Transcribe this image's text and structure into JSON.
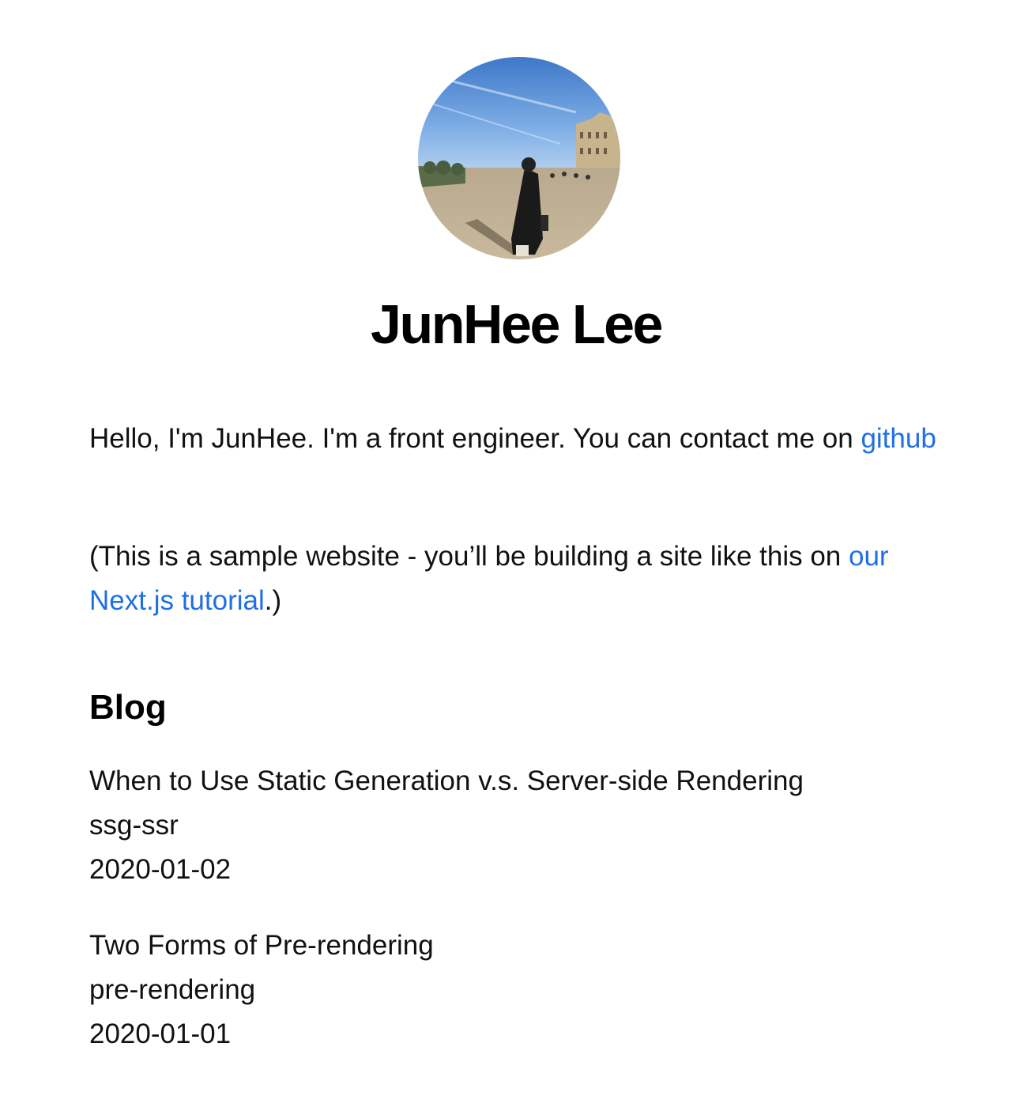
{
  "profile": {
    "avatar_alt": "avatar-photo",
    "name": "JunHee Lee"
  },
  "intro": {
    "text": "Hello, I'm JunHee. I'm a front engineer. You can contact me on ",
    "github_link": "github"
  },
  "note": {
    "prefix": "(This is a sample website - you’ll be building a site like this on ",
    "link": "our Next.js tutorial",
    "suffix": ".)"
  },
  "blog": {
    "heading": "Blog",
    "posts": [
      {
        "title": "When to Use Static Generation v.s. Server-side Rendering",
        "id": "ssg-ssr",
        "date": "2020-01-02"
      },
      {
        "title": "Two Forms of Pre-rendering",
        "id": "pre-rendering",
        "date": "2020-01-01"
      }
    ]
  },
  "colors": {
    "link": "#1f6fe5",
    "text": "#111111"
  }
}
